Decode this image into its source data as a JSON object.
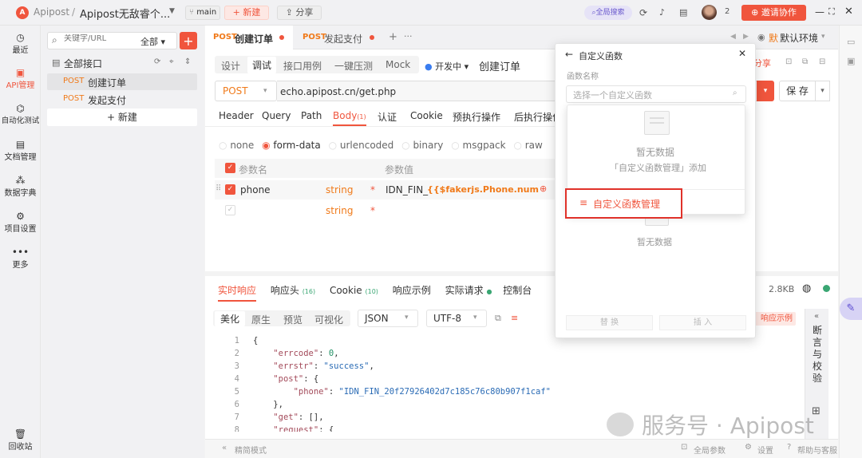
{
  "topbar": {
    "app_name": "Apipost",
    "separator": "/",
    "project": "Apipost无敌睿个...",
    "branch": "main",
    "new_label": "新建",
    "share_label": "分享",
    "global_search": "全局搜索",
    "notif_count": "2",
    "invite_label": "邀请协作"
  },
  "sidebar": {
    "items": [
      {
        "label": "最近"
      },
      {
        "label": "API管理"
      },
      {
        "label": "自动化测试"
      },
      {
        "label": "文档管理"
      },
      {
        "label": "数据字典"
      },
      {
        "label": "项目设置"
      },
      {
        "label": "更多"
      }
    ],
    "trash": "回收站"
  },
  "tree": {
    "search_placeholder": "关键字/URL",
    "filter": "全部",
    "root": "全部接口",
    "items": [
      {
        "method": "POST",
        "name": "创建订单"
      },
      {
        "method": "POST",
        "name": "发起支付"
      }
    ],
    "new_label": "新建"
  },
  "tabs": {
    "items": [
      {
        "method": "POST",
        "name": "创建订单"
      },
      {
        "method": "POST",
        "name": "发起支付"
      }
    ],
    "env": "默认环境",
    "env_badge": "默"
  },
  "subtabs": {
    "items": [
      "设计",
      "调试",
      "接口用例",
      "一键压测",
      "Mock"
    ],
    "status": "开发中",
    "api_name": "创建订单",
    "share": "分享"
  },
  "request": {
    "method": "POST",
    "url": "echo.apipost.cn/get.php",
    "save": "保 存"
  },
  "params_tabs": [
    "Header",
    "Query",
    "Path",
    "Body",
    "认证",
    "Cookie",
    "预执行操作",
    "后执行操作"
  ],
  "body_badge": "(1)",
  "body_types": [
    "none",
    "form-data",
    "urlencoded",
    "binary",
    "msgpack",
    "raw"
  ],
  "table": {
    "col_name": "参数名",
    "col_value": "参数值",
    "rows": [
      {
        "name": "phone",
        "type": "string",
        "value_prefix": "IDN_FIN_",
        "value_expr": "{{$fakerjs.Phone.number|r"
      },
      {
        "name": "",
        "type": "string",
        "value_prefix": "",
        "value_expr": ""
      }
    ]
  },
  "response_tabs": [
    {
      "label": "实时响应",
      "badge": ""
    },
    {
      "label": "响应头",
      "badge": "(16)"
    },
    {
      "label": "Cookie",
      "badge": "(10)"
    },
    {
      "label": "响应示例",
      "badge": ""
    },
    {
      "label": "实际请求",
      "badge": ""
    },
    {
      "label": "控制台",
      "badge": ""
    }
  ],
  "response_size": "2.8KB",
  "view_modes": [
    "美化",
    "原生",
    "预览",
    "可视化"
  ],
  "format": "JSON",
  "encoding": "UTF-8",
  "response_example_btn": "响应示例",
  "assert_panel": "断言与校验",
  "code_lines": [
    "1",
    "2",
    "3",
    "4",
    "5",
    "6",
    "7",
    "8",
    "9"
  ],
  "popup": {
    "title": "自定义函数",
    "field_label": "函数名称",
    "select_placeholder": "选择一个自定义函数",
    "empty_text": "暂无数据",
    "empty_hint": "「自定义函数管理」添加",
    "manage_label": "自定义函数管理",
    "empty_text2": "暂无数据",
    "replace": "替 换",
    "insert": "插 入"
  },
  "footer": {
    "mode": "精简模式",
    "global_params": "全局参数",
    "settings": "设置",
    "help": "帮助与客服"
  },
  "watermark": "服务号 · Apipost",
  "colors": {
    "accent": "#f0553d",
    "method": "#f07a1a",
    "highlight_box": "#e0322a"
  }
}
